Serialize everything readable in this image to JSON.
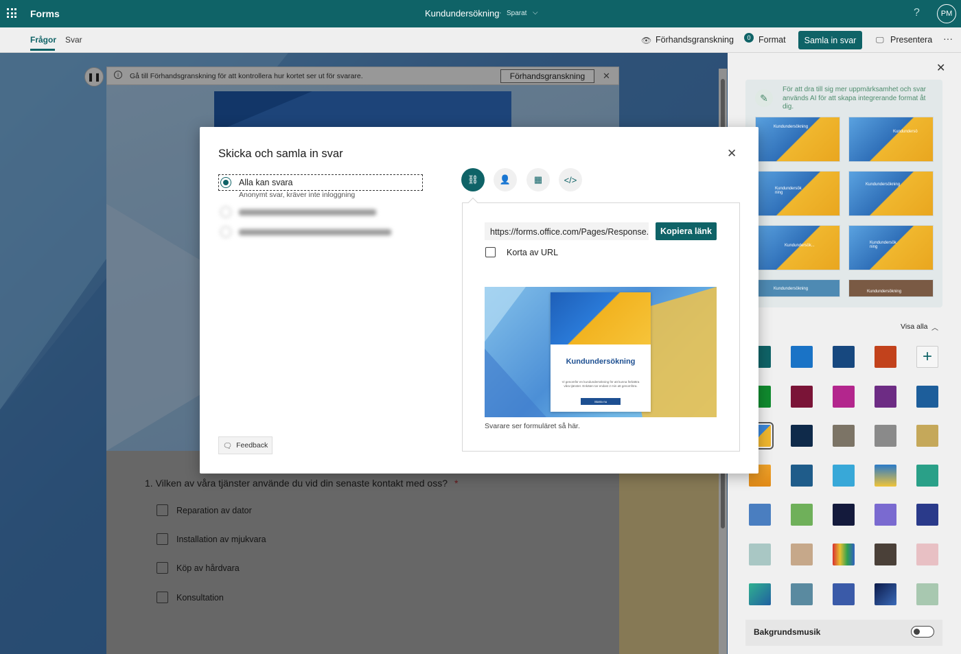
{
  "topbar": {
    "app_name": "Forms",
    "doc_title": "Kundundersökning",
    "separator": "·",
    "saved": "Sparat",
    "help": "?",
    "avatar": "PM"
  },
  "subbar": {
    "tabs": [
      {
        "label": "Frågor"
      },
      {
        "label": "Svar"
      }
    ],
    "preview": "Förhandsgranskning",
    "format": "Format",
    "format_badge": "0",
    "collect": "Samla in svar",
    "present": "Presentera",
    "more": "···"
  },
  "infobar": {
    "text": "Gå till Förhandsgranskning för att kontrollera hur kortet ser ut för svarare.",
    "button": "Förhandsgranskning"
  },
  "question": {
    "text": "1. Vilken av våra tjänster använde du vid din senaste kontakt med oss?",
    "required": "*",
    "options": [
      {
        "label": "Reparation av dator"
      },
      {
        "label": "Installation av mjukvara"
      },
      {
        "label": "Köp av hårdvara"
      },
      {
        "label": "Konsultation"
      }
    ]
  },
  "modal": {
    "title": "Skicka och samla in svar",
    "option1_label": "Alla kan svara",
    "option1_sub": "Anonymt svar, kräver inte inloggning",
    "feedback": "Feedback",
    "url": "https://forms.office.com/Pages/Response...",
    "copy": "Kopiera länk",
    "shorten": "Korta av URL",
    "preview_title": "Kundundersökning",
    "preview_body": "Vi genomför en kundundersökning för att kunna förbättra våra tjänster. Enkäten tar endast 2 min att genomföra.",
    "preview_button": "Starta nu",
    "preview_caption": "Svarare ser formuläret så här."
  },
  "rpanel": {
    "ai_text": "För att dra till sig mer uppmärksamhet och svar används AI för att skapa integrerande format åt dig.",
    "thumbs": [
      {
        "label": "Kundundersökning"
      },
      {
        "label": "Kundundersö"
      },
      {
        "label": "Kundundersök ning"
      },
      {
        "label": "Kundundersökning"
      },
      {
        "label": "Kundundersök..."
      },
      {
        "label": "Kundundersök ning"
      },
      {
        "label": "Kundundersökning"
      },
      {
        "label": "Kundundersökning"
      }
    ],
    "show_all": "Visa alla",
    "bg_music": "Bakgrundsmusik",
    "swatches": [
      [
        "#0f6367",
        "#1a73c6",
        "#17487f",
        "#c2421c",
        "plus"
      ],
      [
        "#108a2e",
        "#7a1437",
        "#b3268d",
        "#6d2c84",
        "#1d5e9b"
      ]
    ]
  },
  "colors": {
    "accent": "#0f6367"
  }
}
